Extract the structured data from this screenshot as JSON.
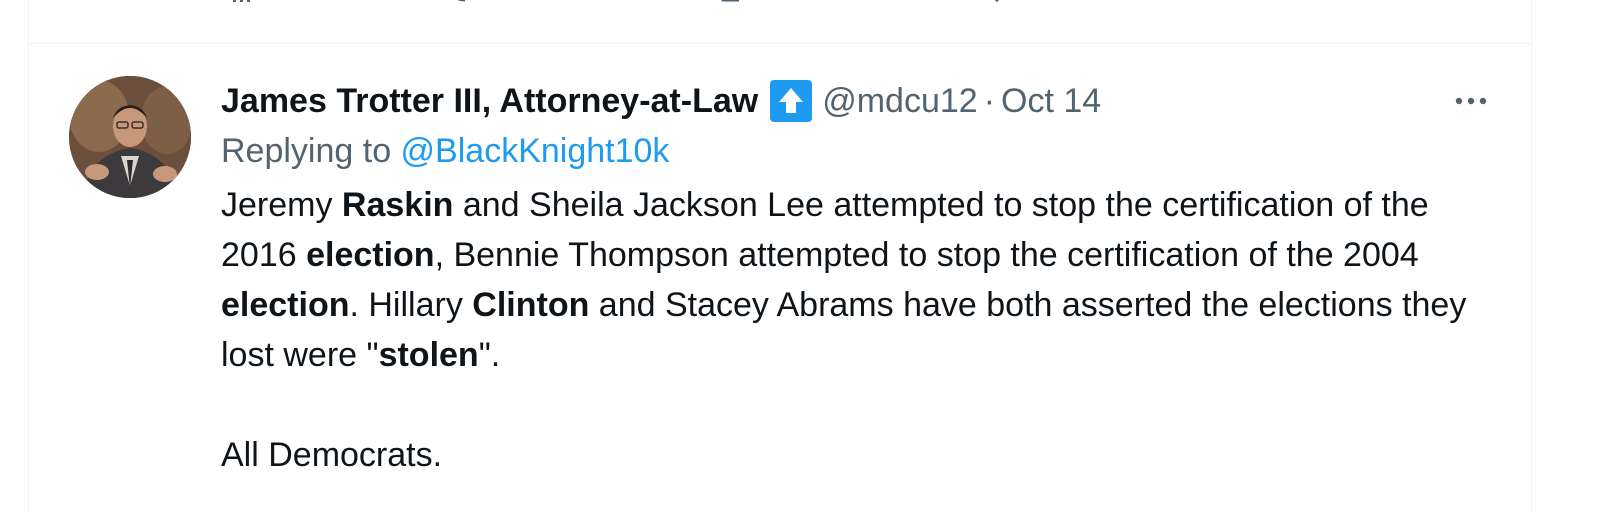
{
  "tweet": {
    "author": {
      "display_name": "James Trotter III, Attorney-at-Law",
      "badge_icon": "up-arrow-badge-icon",
      "handle": "@mdcu12",
      "separator": "·",
      "timestamp": "Oct 14"
    },
    "more_label": "···",
    "reply": {
      "prefix": "Replying to ",
      "mention": "@BlackKnight10k"
    },
    "body": {
      "p1": [
        {
          "text": "Jeremy ",
          "bold": false
        },
        {
          "text": "Raskin",
          "bold": true
        },
        {
          "text": " and Sheila Jackson Lee attempted to stop the certification of the 2016 ",
          "bold": false
        },
        {
          "text": "election",
          "bold": true
        },
        {
          "text": ", Bennie Thompson attempted to stop the certification of the 2004 ",
          "bold": false
        },
        {
          "text": "election",
          "bold": true
        },
        {
          "text": ". Hillary ",
          "bold": false
        },
        {
          "text": "Clinton",
          "bold": true
        },
        {
          "text": " and Stacey Abrams have both asserted the elections they lost were \"",
          "bold": false
        },
        {
          "text": "stolen",
          "bold": true
        },
        {
          "text": "\".",
          "bold": false
        }
      ],
      "p2": "All Democrats."
    }
  },
  "colors": {
    "text": "#0f1419",
    "secondary": "#536471",
    "accent": "#1d9bf0",
    "border": "#eff3f4"
  }
}
